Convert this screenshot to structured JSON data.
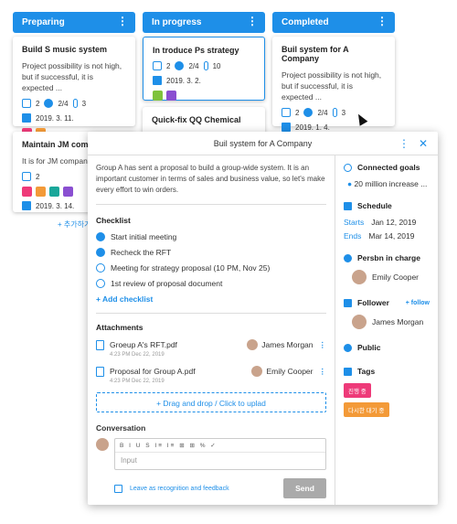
{
  "columns": [
    {
      "title": "Preparing"
    },
    {
      "title": "In progress"
    },
    {
      "title": "Completed"
    }
  ],
  "cards": {
    "c1": {
      "title": "Build S music system",
      "desc": "Project possibility is not high, but if successful, it is expected ...",
      "comments": "2",
      "checks": "2/4",
      "files": "3",
      "date": "2019. 3. 11."
    },
    "c2": {
      "title": "Maintain JM compa",
      "desc": "It is for JM company",
      "comments": "2",
      "date": "2019. 3. 14."
    },
    "c3": {
      "title": "In troduce Ps strategy",
      "comments": "2",
      "checks": "2/4",
      "files": "10",
      "date": "2019. 3. 2."
    },
    "c4": {
      "title": "Quick-fix QQ Chemical"
    },
    "c5": {
      "title": "Buil system for A Company",
      "desc": "Project possibility is not high, but if successful, it is expected ...",
      "comments": "2",
      "checks": "2/4",
      "files": "3",
      "date": "2019. 1. 4."
    }
  },
  "add_card": "+ 추가하기",
  "colors": {
    "accent": "#1e8fe8",
    "pink": "#ee3a79",
    "orange": "#f39a38",
    "green": "#7ec23d",
    "purple": "#8a4fd1",
    "teal": "#1aa79a"
  },
  "modal": {
    "title": "Buil system for A Company",
    "intro": "Group A has sent a proposal to build a group-wide system. It is an important customer in terms of sales and business value, so let's make every effort to win orders.",
    "checklist_label": "Checklist",
    "checklist": [
      {
        "text": "Start initial meeting",
        "done": true
      },
      {
        "text": "Recheck the RFT",
        "done": true
      },
      {
        "text": "Meeting for strategy proposal (10 PM, Nov 25)",
        "done": false
      },
      {
        "text": "1st review of proposal document",
        "done": false
      }
    ],
    "add_checklist": "+ Add checklist",
    "attachments_label": "Attachments",
    "attachments": [
      {
        "name": "Groeup A's RFT.pdf",
        "owner": "James Morgan",
        "time": "4:23 PM Dec 22, 2019"
      },
      {
        "name": "Proposal for Group A.pdf",
        "owner": "Emily Cooper",
        "time": "4:23 PM Dec 22, 2019"
      }
    ],
    "drop": "+ Drag and drop / Click to uplad",
    "conversation": "Conversation",
    "toolbar": "B I U S I≡ I≡ ⊞ ⊞ % ✓",
    "input_placeholder": "Input",
    "feedback": "Leave as recognition and feedback",
    "send": "Send",
    "goals_label": "Connected goals",
    "goal": "20 million increase ...",
    "schedule_label": "Schedule",
    "starts_k": "Starts",
    "starts_v": "Jan 12, 2019",
    "ends_k": "Ends",
    "ends_v": "Mar 14, 2019",
    "person_label": "Persbn in charge",
    "person": "Emily Cooper",
    "follower_label": "Follower",
    "follow_btn": "+ follow",
    "follower": "James Morgan",
    "public": "Public",
    "tags_label": "Tags",
    "tags": [
      "진행 중",
      "다시한 대기 중"
    ]
  }
}
